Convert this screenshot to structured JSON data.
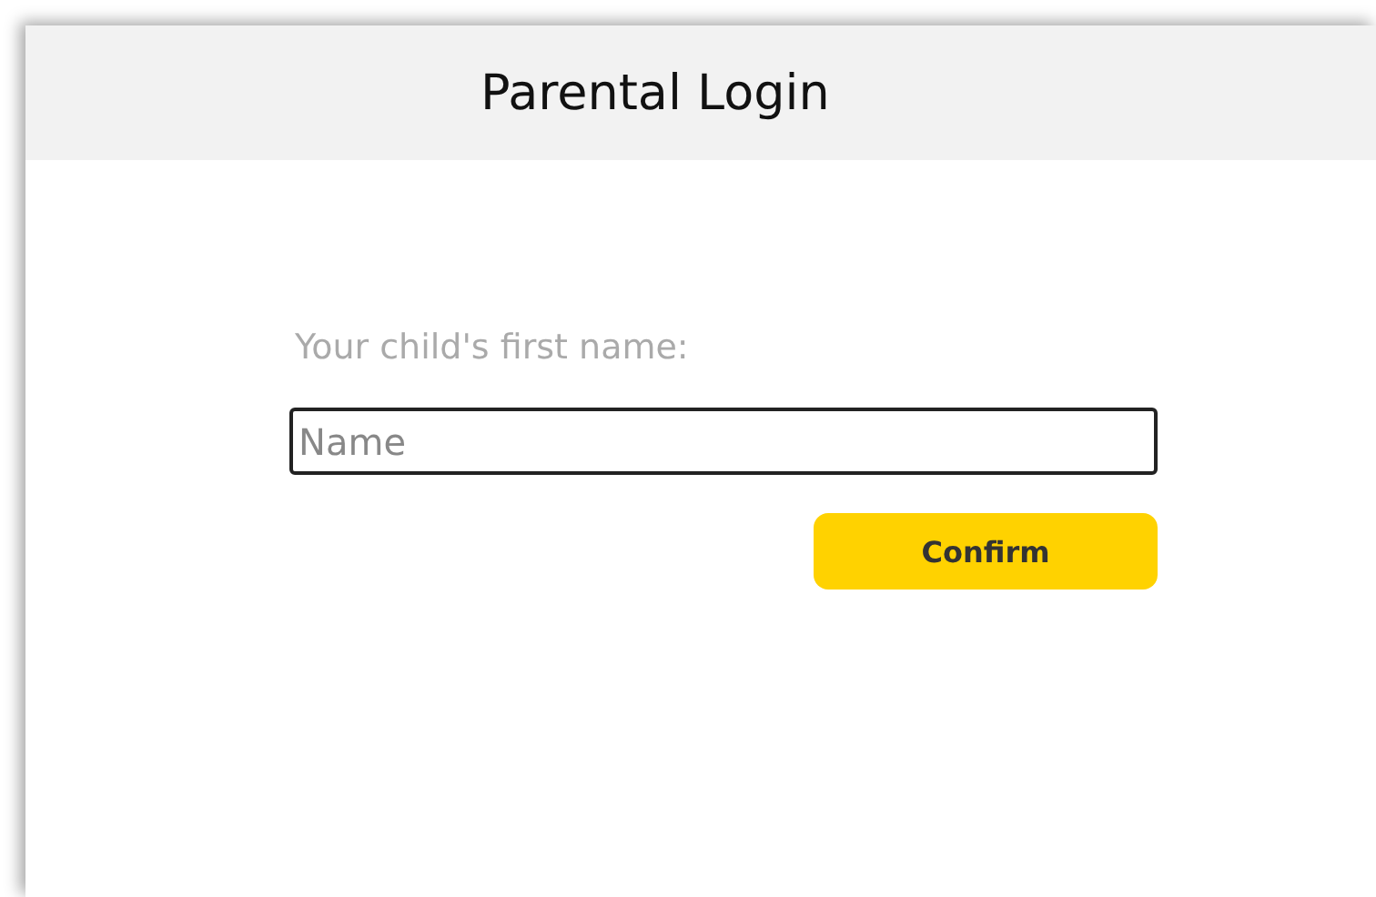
{
  "window": {
    "title": "Parental Login"
  },
  "form": {
    "label": "Your child's first name:",
    "name_field": {
      "placeholder": "Name"
    },
    "button": "Confirm"
  }
}
